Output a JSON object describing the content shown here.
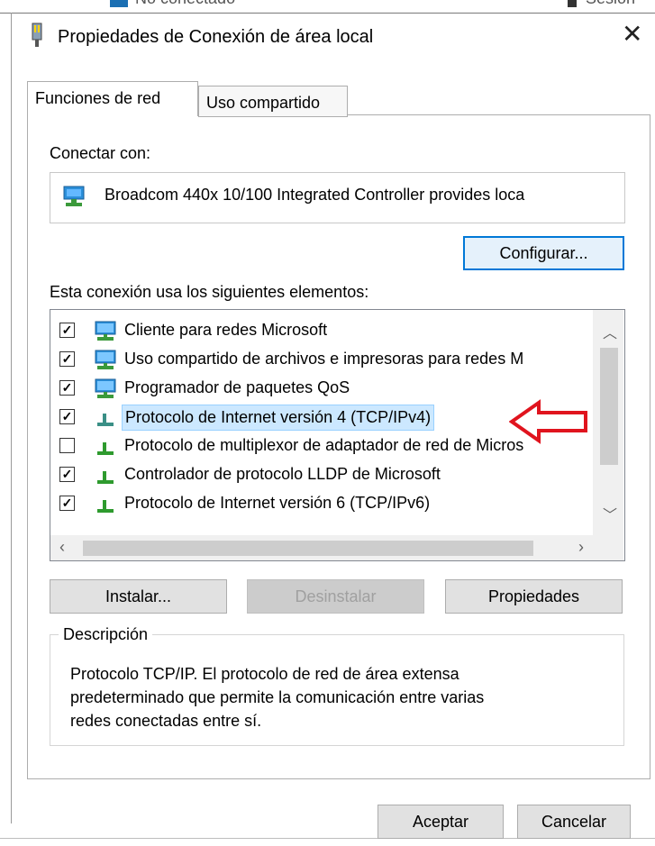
{
  "background_window": {
    "text_left": "No conectado",
    "text_right": "Sesión"
  },
  "dialog": {
    "title": "Propiedades de Conexión de área local",
    "close_symbol": "✕"
  },
  "tabs": [
    {
      "label": "Funciones de red",
      "active": true
    },
    {
      "label": "Uso compartido",
      "active": false
    }
  ],
  "connect_with": {
    "label": "Conectar con:",
    "adapter": "Broadcom 440x 10/100 Integrated Controller provides loca",
    "configure_button": "Configurar..."
  },
  "components": {
    "label": "Esta conexión usa los siguientes elementos:",
    "items": [
      {
        "label": "Cliente para redes Microsoft",
        "checked": true,
        "icon": "network-client-icon"
      },
      {
        "label": "Uso compartido de archivos e impresoras para redes M",
        "checked": true,
        "icon": "network-service-icon"
      },
      {
        "label": "Programador de paquetes QoS",
        "checked": true,
        "icon": "network-service-icon"
      },
      {
        "label": "Protocolo de Internet versión 4 (TCP/IPv4)",
        "checked": true,
        "icon": "protocol-icon",
        "selected": true
      },
      {
        "label": "Protocolo de multiplexor de adaptador de red de Micros",
        "checked": false,
        "icon": "protocol-icon"
      },
      {
        "label": "Controlador de protocolo LLDP de Microsoft",
        "checked": true,
        "icon": "protocol-icon"
      },
      {
        "label": "Protocolo de Internet versión 6 (TCP/IPv6)",
        "checked": true,
        "icon": "protocol-icon"
      }
    ]
  },
  "buttons": {
    "install": "Instalar...",
    "uninstall": "Desinstalar",
    "properties": "Propiedades",
    "ok": "Aceptar",
    "cancel": "Cancelar"
  },
  "description": {
    "legend": "Descripción",
    "text_lines": [
      "Protocolo TCP/IP. El protocolo de red de área extensa",
      "predeterminado que permite la comunicación entre varias",
      "redes conectadas entre sí."
    ]
  },
  "colors": {
    "selection_bg": "#cce8ff",
    "annotation_arrow": "#e0141e",
    "default_button_border": "#0078d7"
  }
}
